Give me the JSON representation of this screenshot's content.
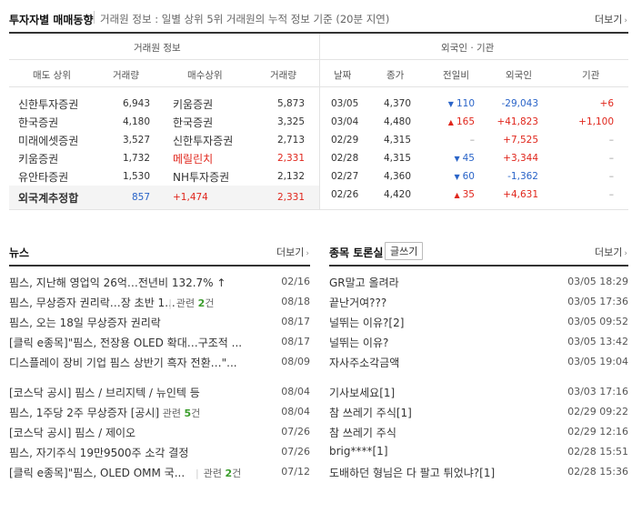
{
  "investor_section": {
    "title": "투자자별 매매동향",
    "subtitle": "거래원 정보 : 일별 상위 5위 거래원의 누적 정보 기준 (20분 지연)",
    "more": "더보기"
  },
  "broker_table": {
    "group_header": "거래원 정보",
    "columns": [
      "매도 상위",
      "거래량",
      "매수상위",
      "거래량"
    ],
    "rows": [
      {
        "sell": "신한투자증권",
        "sell_vol": "6,943",
        "buy": "키움증권",
        "buy_vol": "5,873"
      },
      {
        "sell": "한국증권",
        "sell_vol": "4,180",
        "buy": "한국증권",
        "buy_vol": "3,325"
      },
      {
        "sell": "미래에셋증권",
        "sell_vol": "3,527",
        "buy": "신한투자증권",
        "buy_vol": "2,713"
      },
      {
        "sell": "키움증권",
        "sell_vol": "1,732",
        "buy": "메릴린치",
        "buy_vol": "2,331"
      },
      {
        "sell": "유안타증권",
        "sell_vol": "1,530",
        "buy": "NH투자증권",
        "buy_vol": "2,132"
      }
    ],
    "foreign_total": {
      "label": "외국계추정합",
      "sell_vol": "857",
      "buy_change": "+1,474",
      "buy_vol": "2,331"
    }
  },
  "foreign_table": {
    "group_header": "외국인 · 기관",
    "columns": [
      "날짜",
      "종가",
      "전일비",
      "외국인",
      "기관"
    ],
    "rows": [
      {
        "date": "03/05",
        "close": "4,370",
        "dir": "down",
        "change": "110",
        "foreign": "-29,043",
        "inst": "+6"
      },
      {
        "date": "03/04",
        "close": "4,480",
        "dir": "up",
        "change": "165",
        "foreign": "+41,823",
        "inst": "+1,100"
      },
      {
        "date": "02/29",
        "close": "4,315",
        "dir": "flat",
        "change": "–",
        "foreign": "+7,525",
        "inst": "–"
      },
      {
        "date": "02/28",
        "close": "4,315",
        "dir": "down",
        "change": "45",
        "foreign": "+3,344",
        "inst": "–"
      },
      {
        "date": "02/27",
        "close": "4,360",
        "dir": "down",
        "change": "60",
        "foreign": "-1,362",
        "inst": "–"
      },
      {
        "date": "02/26",
        "close": "4,420",
        "dir": "up",
        "change": "35",
        "foreign": "+4,631",
        "inst": "–"
      }
    ]
  },
  "news": {
    "title": "뉴스",
    "more": "더보기",
    "items": [
      {
        "title": "핌스, 지난해 영업익 26억…전년비 132.7% ↑",
        "date": "02/16"
      },
      {
        "title": "핌스, 무상증자 권리락…장 초반 1...",
        "related_label": "관련",
        "related_count": "2",
        "related_suffix": "건",
        "date": "08/18"
      },
      {
        "title": "핌스, 오는 18일 무상증자 권리락",
        "date": "08/17"
      },
      {
        "title": "[클릭 e종목]\"핌스, 전장용 OLED 확대…구조적 ...",
        "date": "08/17"
      },
      {
        "title": "디스플레이 장비 기업 핌스 상반기 흑자 전환…\"...",
        "date": "08/09"
      },
      {
        "title": "[코스닥 공시] 핌스 / 브리지텍 / 뉴인텍 등",
        "date": "08/04"
      },
      {
        "title": "핌스, 1주당 2주 무상증자 [공시]",
        "related_label": "관련",
        "related_count": "5",
        "related_suffix": "건",
        "date": "08/04"
      },
      {
        "title": "[코스닥 공시] 핌스 / 제이오",
        "date": "07/26"
      },
      {
        "title": "핌스, 자기주식 19만9500주 소각 결정",
        "date": "07/26"
      },
      {
        "title": "[클릭 e종목]\"핌스, OLED OMM 국...",
        "related_label": "관련",
        "related_count": "2",
        "related_suffix": "건",
        "date": "07/12"
      }
    ]
  },
  "discussion": {
    "title": "종목 토론실",
    "write_button": "글쓰기",
    "more": "더보기",
    "items": [
      {
        "title": "GR말고 올려라",
        "date": "03/05 18:29"
      },
      {
        "title": "끝난거여???",
        "date": "03/05 17:36"
      },
      {
        "title": "널뛰는 이유?[2]",
        "date": "03/05 09:52"
      },
      {
        "title": "널뛰는 이유?",
        "date": "03/05 13:42"
      },
      {
        "title": "자사주소각금액",
        "date": "03/05 19:04"
      },
      {
        "title": "기사보세요[1]",
        "date": "03/03 17:16"
      },
      {
        "title": "참 쓰레기 주식[1]",
        "date": "02/29 09:22"
      },
      {
        "title": "참 쓰레기 주식",
        "date": "02/29 12:16"
      },
      {
        "title": "brig****[1]",
        "date": "02/28 15:51"
      },
      {
        "title": "도배하던 형님은 다 팔고 튀었냐?[1]",
        "date": "02/28 15:36"
      }
    ]
  },
  "colors": {
    "up": "#e0261c",
    "down": "#2a64c8",
    "related_count": "#3a9d2b"
  }
}
